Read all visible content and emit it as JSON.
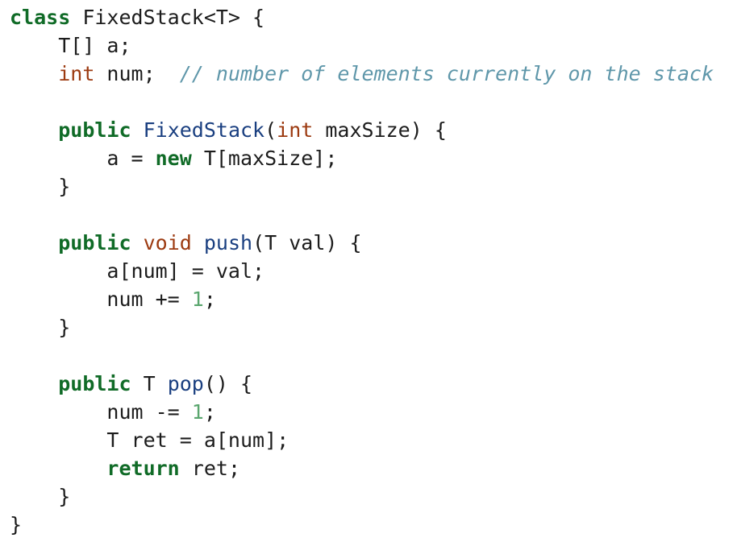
{
  "code": {
    "language": "Java",
    "lines": [
      [
        [
          "keyword",
          "class"
        ],
        [
          "plain",
          " FixedStack<T> {"
        ]
      ],
      [
        [
          "plain",
          "    T[] a;"
        ]
      ],
      [
        [
          "plain",
          "    "
        ],
        [
          "type",
          "int"
        ],
        [
          "plain",
          " num;  "
        ],
        [
          "comment",
          "// number of elements currently on the stack"
        ]
      ],
      [],
      [
        [
          "plain",
          "    "
        ],
        [
          "keyword",
          "public"
        ],
        [
          "plain",
          " "
        ],
        [
          "name",
          "FixedStack"
        ],
        [
          "plain",
          "("
        ],
        [
          "type",
          "int"
        ],
        [
          "plain",
          " maxSize) {"
        ]
      ],
      [
        [
          "plain",
          "        a = "
        ],
        [
          "keyword",
          "new"
        ],
        [
          "plain",
          " T[maxSize];"
        ]
      ],
      [
        [
          "plain",
          "    }"
        ]
      ],
      [],
      [
        [
          "plain",
          "    "
        ],
        [
          "keyword",
          "public"
        ],
        [
          "plain",
          " "
        ],
        [
          "type",
          "void"
        ],
        [
          "plain",
          " "
        ],
        [
          "name",
          "push"
        ],
        [
          "plain",
          "(T val) {"
        ]
      ],
      [
        [
          "plain",
          "        a[num] = val;"
        ]
      ],
      [
        [
          "plain",
          "        num += "
        ],
        [
          "number",
          "1"
        ],
        [
          "plain",
          ";"
        ]
      ],
      [
        [
          "plain",
          "    }"
        ]
      ],
      [],
      [
        [
          "plain",
          "    "
        ],
        [
          "keyword",
          "public"
        ],
        [
          "plain",
          " T "
        ],
        [
          "name",
          "pop"
        ],
        [
          "plain",
          "() {"
        ]
      ],
      [
        [
          "plain",
          "        num -= "
        ],
        [
          "number",
          "1"
        ],
        [
          "plain",
          ";"
        ]
      ],
      [
        [
          "plain",
          "        T ret = a[num];"
        ]
      ],
      [
        [
          "plain",
          "        "
        ],
        [
          "keyword",
          "return"
        ],
        [
          "plain",
          " ret;"
        ]
      ],
      [
        [
          "plain",
          "    }"
        ]
      ],
      [
        [
          "plain",
          "}"
        ]
      ]
    ]
  },
  "colors": {
    "keyword": "#106b27",
    "type": "#9c3a10",
    "name": "#1a3f80",
    "number": "#5aa66e",
    "comment": "#5f97aa",
    "plain": "#1c1c1c",
    "background": "#ffffff"
  }
}
